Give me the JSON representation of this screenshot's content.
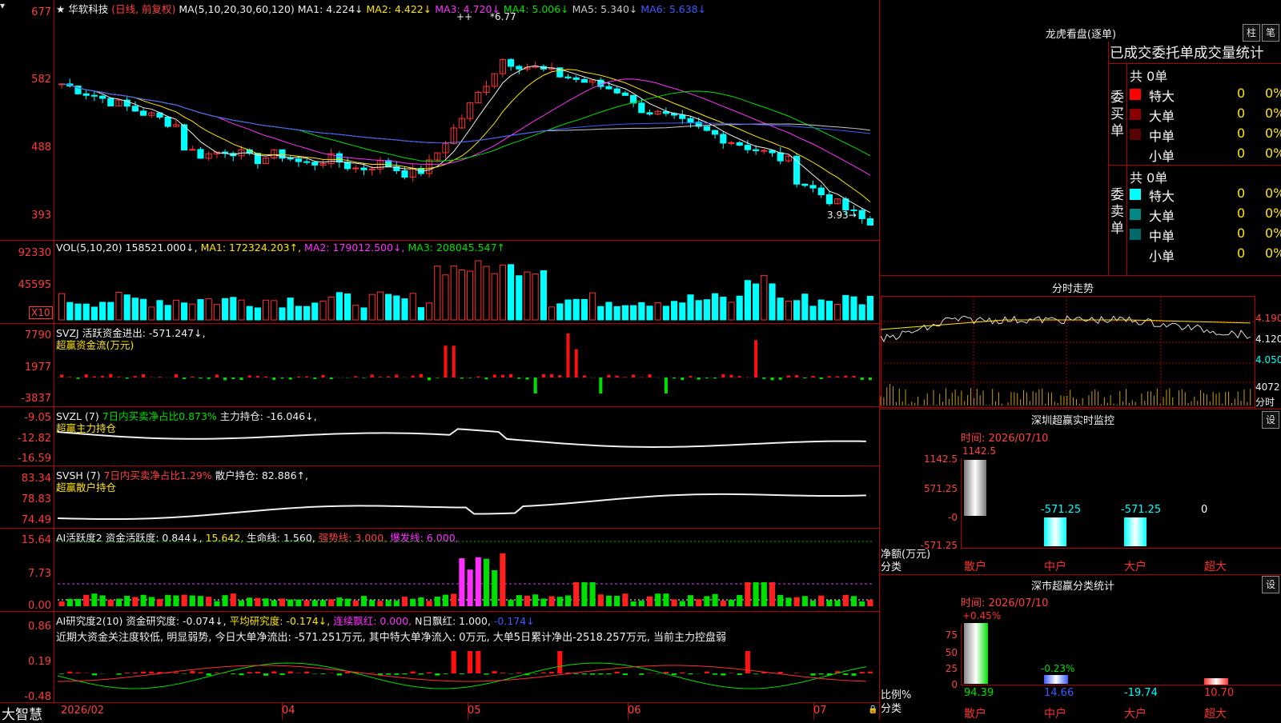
{
  "main": {
    "stock_name": "华软科技",
    "mode": "(日线, 前复权)",
    "ma_label": "MA(5,10,20,30,60,120)",
    "ma_items": [
      {
        "label": "MA1:",
        "value": "4.224",
        "arrow": "↓",
        "color": "#f0f0f0"
      },
      {
        "label": "MA2:",
        "value": "4.422",
        "arrow": "↓",
        "color": "#ffe600"
      },
      {
        "label": "MA3:",
        "value": "4.720",
        "arrow": "↓",
        "color": "#ff30ff"
      },
      {
        "label": "MA4:",
        "value": "5.006",
        "arrow": "↓",
        "color": "#00e000"
      },
      {
        "label": "MA5:",
        "value": "5.340",
        "arrow": "↓",
        "color": "#c8c8c8"
      },
      {
        "label": "MA6:",
        "value": "5.638",
        "arrow": "↓",
        "color": "#3b5bff"
      }
    ],
    "y_ticks": [
      "677",
      "582",
      "488",
      "393"
    ],
    "high_label": "6.77",
    "low_label": "3.93"
  },
  "vol": {
    "head": "VOL(5,10,20)",
    "value": "158521.000↓,",
    "ma1": "MA1: 172324.203↑,",
    "ma2": "MA2: 179012.500↓,",
    "ma3": "MA3: 208045.547↑",
    "y_ticks": [
      "92330",
      "45595"
    ],
    "unit": "X10"
  },
  "svzj": {
    "head": "SVZJ  活跃资金进出: -571.247↓,",
    "sub": "超赢资金流(万元)",
    "y_ticks": [
      "7790",
      "1977",
      "-3837"
    ]
  },
  "svzl": {
    "head1": "SVZL (7)",
    "head2": "7日内买卖净占比0.873%",
    "head3": "主力持仓: -16.046↓,",
    "sub": "超赢主力持仓",
    "y_ticks": [
      "-9.05",
      "-12.82",
      "-16.59"
    ]
  },
  "svsh": {
    "head1": "SVSH (7)",
    "head2": "7日内买卖净占比1.29%",
    "head3": "散户持仓: 82.886↑,",
    "sub": "超赢散户持仓",
    "y_ticks": [
      "83.34",
      "78.83",
      "74.49"
    ]
  },
  "ai1": {
    "head1": "AI活跃度2",
    "head2": "资金活跃度: 0.844↓,",
    "head3": "15.642,",
    "head4": "生命线: 1.560,",
    "head5": "强势线: 3.000,",
    "head6": "爆发线: 6.000,",
    "y_ticks": [
      "15.64",
      "7.73",
      "0.00"
    ]
  },
  "ai2": {
    "head1": "AI研究度2(10)",
    "head2": "资金研究度: -0.074↓,",
    "head3": "平均研究度: -0.174↓,",
    "head4": "连续飘红: 0.000,",
    "head5": "N日飘红: 1.000,",
    "head6": "-0.174↓",
    "comment": "近期大资金关注度较低, 明显弱势, 今日大单净流出: -571.251万元, 其中特大单净流入: 0万元, 大单5日累计净出-2518.257万元, 当前主力控盘弱",
    "y_ticks": [
      "0.86",
      "0.19",
      "-0.48"
    ]
  },
  "footer": {
    "brand": "大智慧",
    "dates": [
      "2026/02",
      "04",
      "05",
      "06",
      "07"
    ]
  },
  "right": {
    "longhu_title": "龙虎看盘(逐单)",
    "btn_zhu": "柱",
    "btn_bi": "笔",
    "table_title": "已成交委托单成交量统计",
    "buy_label": "委买单",
    "sell_label": "委卖单",
    "buy_total": "共 0单",
    "sell_total": "共 0单",
    "buy_rows": [
      {
        "name": "特大",
        "count": "0",
        "pct": "0%",
        "color": "#ff0000"
      },
      {
        "name": "大单",
        "count": "0",
        "pct": "0%",
        "color": "#8a0000"
      },
      {
        "name": "中单",
        "count": "0",
        "pct": "0%",
        "color": "#5a0000"
      },
      {
        "name": "小单",
        "count": "0",
        "pct": "0%",
        "color": ""
      }
    ],
    "sell_rows": [
      {
        "name": "特大",
        "count": "0",
        "pct": "0%",
        "color": "#00ffff"
      },
      {
        "name": "大单",
        "count": "0",
        "pct": "0%",
        "color": "#008888"
      },
      {
        "name": "中单",
        "count": "0",
        "pct": "0%",
        "color": "#006a6a"
      },
      {
        "name": "小单",
        "count": "0",
        "pct": "0%",
        "color": ""
      }
    ],
    "intraday_title": "分时走势",
    "intraday_ticks": [
      "4.190",
      "4.120",
      "4.050",
      "4072",
      "分时"
    ],
    "sz_title": "深圳超赢实时监控",
    "sz_btn": "设",
    "sz_time": "时间: 2026/07/10",
    "sz_top": "1142.5",
    "sz_y": [
      "1142.5",
      "571.25",
      "-0",
      "-571.25"
    ],
    "sz_yl": "净额(万元)",
    "sz_fl": "分类",
    "sz_values": [
      "",
      "-571.25",
      "-571.25",
      "0"
    ],
    "sz_cats": [
      "散户",
      "中户",
      "大户",
      "超大"
    ],
    "ss_title": "深市超赢分类统计",
    "ss_btn": "设",
    "ss_time": "时间: 2026/07/10",
    "ss_y": [
      "75",
      "50",
      "25",
      "0"
    ],
    "ss_yl": "比例%",
    "ss_fl": "分类",
    "ss_pct_labels": [
      "+0.45%",
      "-0.23%"
    ],
    "ss_values": [
      "94.39",
      "14.66",
      "-19.74",
      "10.70"
    ],
    "ss_cats": [
      "散户",
      "中户",
      "大户",
      "超大"
    ]
  }
}
